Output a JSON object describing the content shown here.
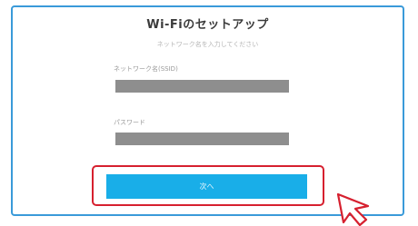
{
  "dialog": {
    "title": "Wi-Fiのセットアップ",
    "subtitle": "ネットワーク名を入力してください"
  },
  "fields": {
    "network_name": {
      "label": "ネットワーク名(SSID)",
      "value": "",
      "hint": ""
    },
    "password": {
      "label": "パスワード",
      "value": "",
      "hint": ""
    }
  },
  "actions": {
    "ok_label": "次へ"
  },
  "colors": {
    "panel_border": "#3a9ad9",
    "highlight_frame": "#d6202f",
    "button": "#19aee8",
    "input_redacted": "#8e8e8e"
  },
  "icons": {
    "cursor": "mouse-pointer-icon"
  }
}
